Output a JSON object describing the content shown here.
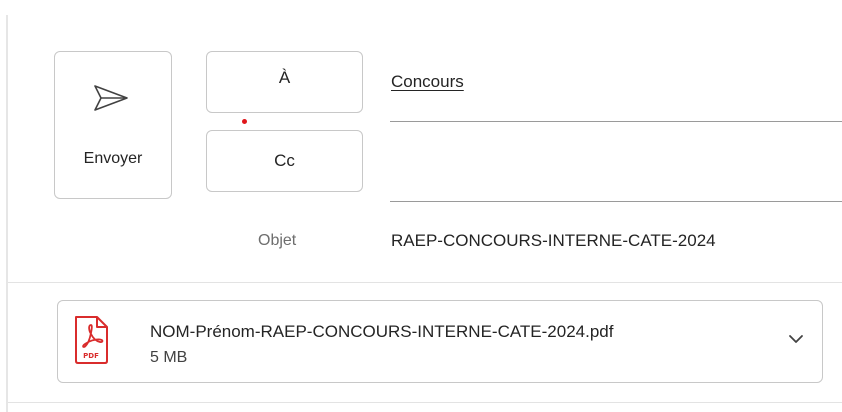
{
  "compose": {
    "send_label": "Envoyer",
    "to_label": "À",
    "cc_label": "Cc",
    "to_value": "Concours",
    "cc_value": "",
    "subject_label": "Objet",
    "subject_value": "RAEP-CONCOURS-INTERNE-CATE-2024"
  },
  "attachment": {
    "name": "NOM-Prénom-RAEP-CONCOURS-INTERNE-CATE-2024.pdf",
    "size": "5 MB",
    "icon": "pdf-file-icon",
    "icon_badge": "PDF"
  },
  "icons": {
    "send": "send-icon",
    "chevron": "chevron-down-icon"
  },
  "colors": {
    "pdf_red": "#d92c2c",
    "required_dot": "#e0161b"
  }
}
